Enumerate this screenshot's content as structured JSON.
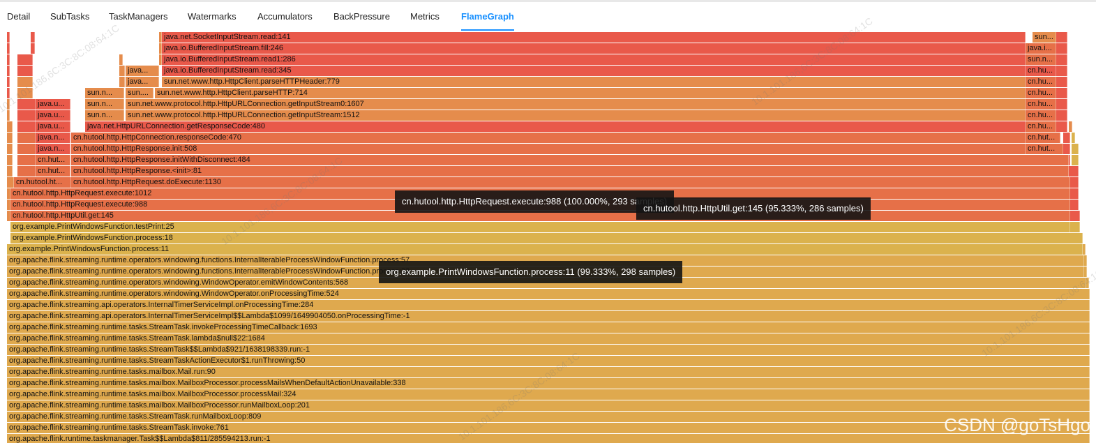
{
  "tabs": [
    {
      "label": "Detail"
    },
    {
      "label": "SubTasks"
    },
    {
      "label": "TaskManagers"
    },
    {
      "label": "Watermarks"
    },
    {
      "label": "Accumulators"
    },
    {
      "label": "BackPressure"
    },
    {
      "label": "Metrics"
    },
    {
      "label": "FlameGraph",
      "active": true
    }
  ],
  "colors": {
    "accent": "#1890ff",
    "frame_red": "#e9594a",
    "frame_orange_red": "#e67048",
    "frame_orange": "#e58c4c",
    "frame_gold": "#dfa94e",
    "frame_yellow": "#dbb24d"
  },
  "flame_frames": [
    {
      "label": "java.net.SocketInputStream.read:141",
      "color": "#e9594a"
    },
    {
      "label": "sun...",
      "color": "#e58c4c"
    },
    {
      "label": "java.io.BufferedInputStream.fill:246",
      "color": "#e9594a"
    },
    {
      "label": "java.i...",
      "color": "#e67048"
    },
    {
      "label": "java.io.BufferedInputStream.read1:286",
      "color": "#e9594a"
    },
    {
      "label": "sun.n...",
      "color": "#e67048"
    },
    {
      "label": "java...",
      "color": "#e58c4c"
    },
    {
      "label": "java.io.BufferedInputStream.read:345",
      "color": "#e9594a"
    },
    {
      "label": "cn.hu...",
      "color": "#e9594a"
    },
    {
      "label": "java...",
      "color": "#e58c4c"
    },
    {
      "label": "sun.net.www.http.HttpClient.parseHTTPHeader:779",
      "color": "#e58c4c"
    },
    {
      "label": "cn.hu...",
      "color": "#e67048"
    },
    {
      "label": "sun.n...",
      "color": "#e58c4c"
    },
    {
      "label": "sun....",
      "color": "#e58c4c"
    },
    {
      "label": "sun.net.www.http.HttpClient.parseHTTP:714",
      "color": "#e58c4c"
    },
    {
      "label": "cn.hu...",
      "color": "#e67048"
    },
    {
      "label": "java.u...",
      "color": "#e9594a"
    },
    {
      "label": "sun.n...",
      "color": "#e58c4c"
    },
    {
      "label": "sun.net.www.protocol.http.HttpURLConnection.getInputStream0:1607",
      "color": "#e58c4c"
    },
    {
      "label": "cn.hu...",
      "color": "#e67048"
    },
    {
      "label": "java.u...",
      "color": "#e9594a"
    },
    {
      "label": "sun.n...",
      "color": "#e58c4c"
    },
    {
      "label": "sun.net.www.protocol.http.HttpURLConnection.getInputStream:1512",
      "color": "#e58c4c"
    },
    {
      "label": "cn.hu...",
      "color": "#e67048"
    },
    {
      "label": "java.u...",
      "color": "#e9594a"
    },
    {
      "label": "java.net.HttpURLConnection.getResponseCode:480",
      "color": "#e9594a"
    },
    {
      "label": "cn.hu...",
      "color": "#e67048"
    },
    {
      "label": "java.n...",
      "color": "#e9594a"
    },
    {
      "label": "cn.hutool.http.HttpConnection.responseCode:470",
      "color": "#e67048"
    },
    {
      "label": "cn.hut...",
      "color": "#e67048"
    },
    {
      "label": "java.n...",
      "color": "#e9594a"
    },
    {
      "label": "cn.hutool.http.HttpResponse.init:508",
      "color": "#e67048"
    },
    {
      "label": "cn.hut...",
      "color": "#e67048"
    },
    {
      "label": "cn.hut...",
      "color": "#e67048"
    },
    {
      "label": "cn.hutool.http.HttpResponse.initWithDisconnect:484",
      "color": "#e67048"
    },
    {
      "label": "cn.hut...",
      "color": "#e67048"
    },
    {
      "label": "cn.hutool.http.HttpResponse.<init>:81",
      "color": "#e67048"
    },
    {
      "label": "cn.hutool.ht...",
      "color": "#e67048"
    },
    {
      "label": "cn.hutool.http.HttpRequest.doExecute:1130",
      "color": "#e67048"
    },
    {
      "label": "cn.hutool.http.HttpRequest.execute:1012",
      "color": "#e67048"
    },
    {
      "label": "cn.hutool.http.HttpRequest.execute:988",
      "color": "#e67048"
    },
    {
      "label": "cn.hutool.http.HttpUtil.get:145",
      "color": "#e67048"
    },
    {
      "label": "org.example.PrintWindowsFunction.testPrint:25",
      "color": "#dbb24d"
    },
    {
      "label": "org.example.PrintWindowsFunction.process:18",
      "color": "#dbb24d"
    },
    {
      "label": "org.example.PrintWindowsFunction.process:11",
      "color": "#dbb24d"
    },
    {
      "label": "org.apache.flink.streaming.runtime.operators.windowing.functions.InternalIterableProcessWindowFunction.process:57",
      "color": "#dfa94e"
    },
    {
      "label": "org.apache.flink.streaming.runtime.operators.windowing.functions.InternalIterableProcessWindowFunction.process:32",
      "color": "#dfa94e"
    },
    {
      "label": "org.apache.flink.streaming.runtime.operators.windowing.WindowOperator.emitWindowContents:568",
      "color": "#dfa94e"
    },
    {
      "label": "org.apache.flink.streaming.runtime.operators.windowing.WindowOperator.onProcessingTime:524",
      "color": "#dfa94e"
    },
    {
      "label": "org.apache.flink.streaming.api.operators.InternalTimerServiceImpl.onProcessingTime:284",
      "color": "#dfa94e"
    },
    {
      "label": "org.apache.flink.streaming.api.operators.InternalTimerServiceImpl$$Lambda$1099/1649904050.onProcessingTime:-1",
      "color": "#dfa94e"
    },
    {
      "label": "org.apache.flink.streaming.runtime.tasks.StreamTask.invokeProcessingTimeCallback:1693",
      "color": "#dfa94e"
    },
    {
      "label": "org.apache.flink.streaming.runtime.tasks.StreamTask.lambda$null$22:1684",
      "color": "#dfa94e"
    },
    {
      "label": "org.apache.flink.streaming.runtime.tasks.StreamTask$$Lambda$921/1638198339.run:-1",
      "color": "#dfa94e"
    },
    {
      "label": "org.apache.flink.streaming.runtime.tasks.StreamTaskActionExecutor$1.runThrowing:50",
      "color": "#dfa94e"
    },
    {
      "label": "org.apache.flink.streaming.runtime.tasks.mailbox.Mail.run:90",
      "color": "#dfa94e"
    },
    {
      "label": "org.apache.flink.streaming.runtime.tasks.mailbox.MailboxProcessor.processMailsWhenDefaultActionUnavailable:338",
      "color": "#dfa94e"
    },
    {
      "label": "org.apache.flink.streaming.runtime.tasks.mailbox.MailboxProcessor.processMail:324",
      "color": "#dfa94e"
    },
    {
      "label": "org.apache.flink.streaming.runtime.tasks.mailbox.MailboxProcessor.runMailboxLoop:201",
      "color": "#dfa94e"
    },
    {
      "label": "org.apache.flink.streaming.runtime.tasks.StreamTask.runMailboxLoop:809",
      "color": "#dfa94e"
    },
    {
      "label": "org.apache.flink.streaming.runtime.tasks.StreamTask.invoke:761",
      "color": "#dfa94e"
    },
    {
      "label": "org.apache.flink.runtime.taskmanager.Task$$Lambda$811/285594213.run:-1",
      "color": "#dfa94e"
    }
  ],
  "tooltips": [
    {
      "label": "cn.hutool.http.HttpRequest.execute:988 (100.000%, 293 samples)"
    },
    {
      "label": "cn.hutool.http.HttpUtil.get:145 (95.333%, 286 samples)"
    },
    {
      "label": "org.example.PrintWindowsFunction.process:11 (99.333%, 298 samples)"
    }
  ],
  "watermarks": [
    {
      "label": "10.1.101.186,6C:3C:8C:08:64:1C"
    }
  ],
  "csdn_mark": "CSDN @goTsHgo"
}
